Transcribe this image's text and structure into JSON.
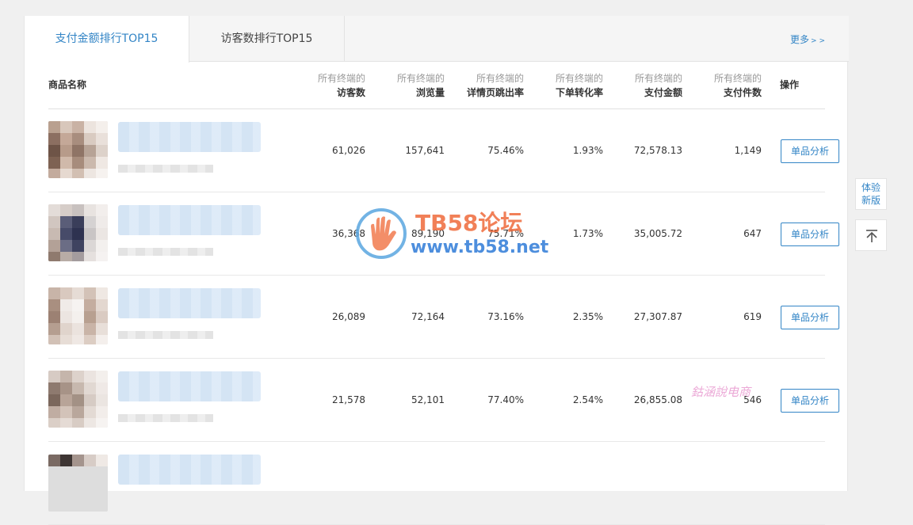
{
  "tabs": {
    "active_label": "支付金额排行TOP15",
    "second_label": "访客数排行TOP15",
    "more_label": "更多",
    "more_arrow": "> >"
  },
  "table": {
    "headers": {
      "product_name": "商品名称",
      "prefix": "所有终端的",
      "visitors": "访客数",
      "pageviews": "浏览量",
      "bounce": "详情页跳出率",
      "conversion": "下单转化率",
      "amount": "支付金额",
      "items": "支付件数",
      "action": "操作"
    },
    "rows": [
      {
        "visitors": "61,026",
        "pageviews": "157,641",
        "bounce": "75.46%",
        "conversion": "1.93%",
        "amount": "72,578.13",
        "items": "1,149",
        "action": "单品分析"
      },
      {
        "visitors": "36,368",
        "pageviews": "89,190",
        "bounce": "75.71%",
        "conversion": "1.73%",
        "amount": "35,005.72",
        "items": "647",
        "action": "单品分析"
      },
      {
        "visitors": "26,089",
        "pageviews": "72,164",
        "bounce": "73.16%",
        "conversion": "2.35%",
        "amount": "27,307.87",
        "items": "619",
        "action": "单品分析"
      },
      {
        "visitors": "21,578",
        "pageviews": "52,101",
        "bounce": "77.40%",
        "conversion": "2.54%",
        "amount": "26,855.08",
        "items": "546",
        "action": "单品分析"
      }
    ]
  },
  "side": {
    "new_version_line1": "体验",
    "new_version_line2": "新版"
  },
  "watermark": {
    "title": "TB58论坛",
    "url": "www.tb58.net",
    "signature": "鈷涵說电商"
  },
  "colors": {
    "accent": "#3385c6",
    "watermark_orange": "#ef6b3b",
    "watermark_blue": "#2e7bd8"
  }
}
